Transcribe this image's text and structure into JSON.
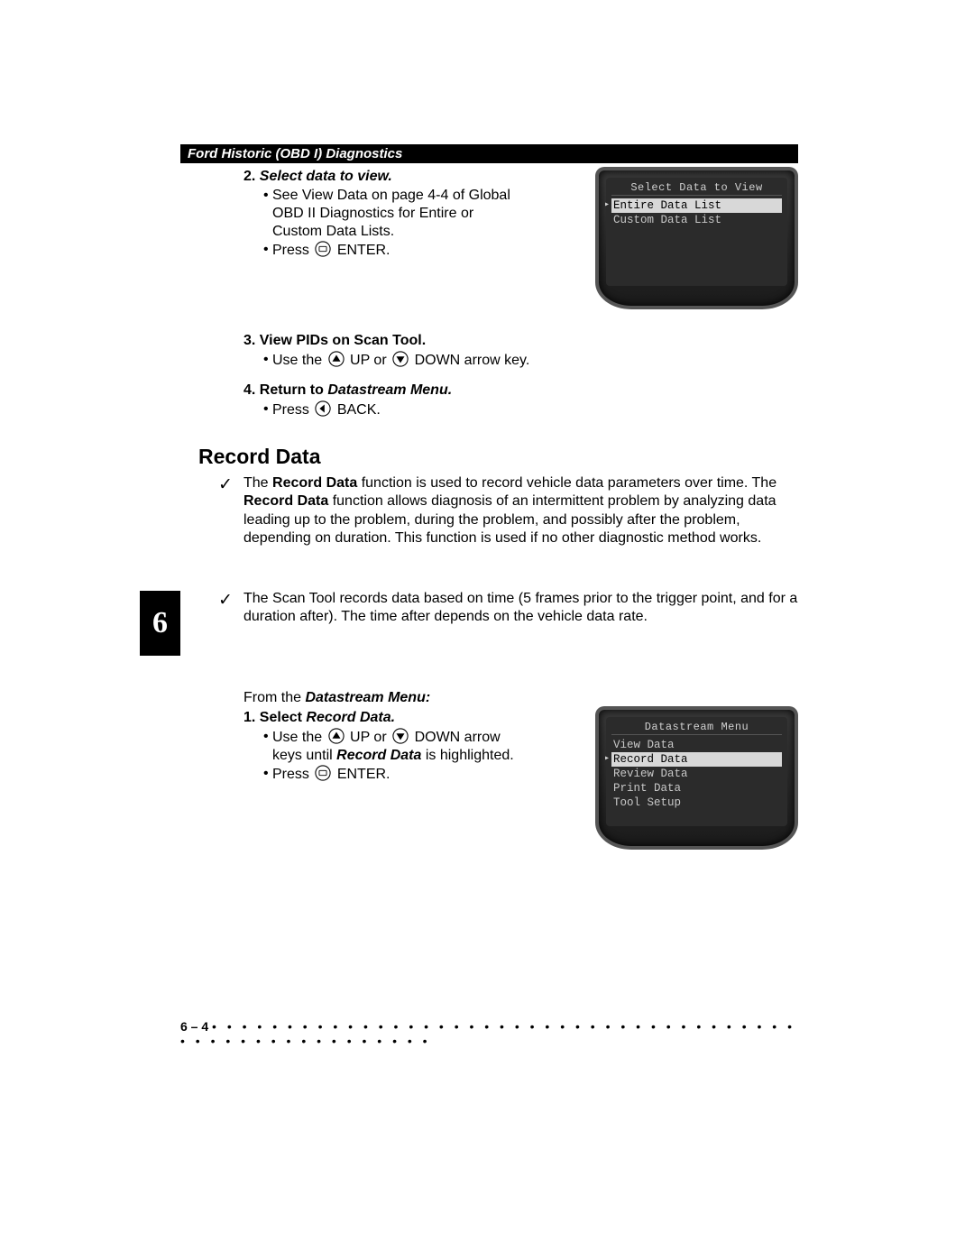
{
  "header": "Ford Historic (OBD I) Diagnostics",
  "step2": {
    "num": "2.",
    "title": "Select data to view.",
    "bullets": {
      "b1": "See View Data on page 4-4 of Global OBD II Diagnostics for Entire or Custom Data Lists.",
      "b2_pre": "Press",
      "b2_post": "ENTER."
    }
  },
  "screen1": {
    "title": "Select Data to View",
    "item1": "Entire Data List",
    "item2": "Custom Data List"
  },
  "step3": {
    "num": "3.",
    "title": "View PIDs on Scan Tool.",
    "b1_pre": "Use the",
    "b1_mid": "UP or",
    "b1_post": "DOWN arrow key."
  },
  "step4": {
    "num": "4.",
    "title_pre": "Return to ",
    "title_em": "Datastream Menu.",
    "b1_pre": "Press",
    "b1_post": "BACK."
  },
  "section": "Record Data",
  "para1_a": "The ",
  "para1_b": "Record Data",
  "para1_c": " function is used to record vehicle data parameters over time. The ",
  "para1_d": "Record Data",
  "para1_e": " function allows diagnosis of an intermittent problem by analyzing data leading up to the problem, during the problem, and possibly after the problem, depending on duration. This function is used if no other diagnostic method works.",
  "para2": "The Scan Tool records data based on time (5 frames prior to the trigger point, and for a duration after). The time after depends on the vehicle data rate.",
  "from_pre": "From the ",
  "from_em": "Datastream Menu:",
  "stepR": {
    "num": "1.",
    "title_pre": "Select ",
    "title_em": "Record Data.",
    "b1_pre": "Use the",
    "b1_mid": "UP or",
    "b1_post": "DOWN arrow keys until ",
    "b1_em": "Record Data",
    "b1_tail": " is highlighted.",
    "b2_pre": "Press",
    "b2_post": "ENTER."
  },
  "screen2": {
    "title": "Datastream Menu",
    "i1": "View Data",
    "i2": "Record Data",
    "i3": "Review Data",
    "i4": "Print Data",
    "i5": "Tool Setup"
  },
  "sidetab": "6",
  "footer_page": "6 – 4",
  "footer_dots": "• • • • • • • • • • • • • • • • • • • • • • • • • • • • • • • • • • • • • • • • • • • • • • • • • • • • • • • •"
}
